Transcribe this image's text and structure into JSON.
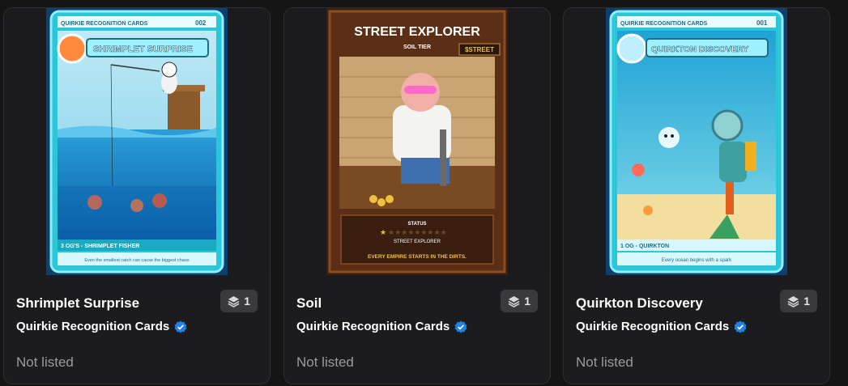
{
  "colors": {
    "background": "#151516",
    "card": "#202022",
    "verified": "#2081e2",
    "muted": "#9a9a9f"
  },
  "cards": [
    {
      "title": "Shrimplet Surprise",
      "quantity": "1",
      "collection": "Quirkie Recognition Cards",
      "status": "Not listed",
      "art": {
        "header": "QUIRKIE RECOGNITION CARDS",
        "number": "002",
        "name": "SHRIMPLET SURPRISE",
        "caption": "3 OG'S - SHRIMPLET FISHER",
        "footer": "Even the smallest catch can cause the biggest chaos"
      }
    },
    {
      "title": "Soil",
      "quantity": "1",
      "collection": "Quirkie Recognition Cards",
      "status": "Not listed",
      "art": {
        "name": "STREET EXPLORER",
        "tier": "SOIL TIER",
        "ticker": "$STREET",
        "status_label": "STATUS",
        "rank": "STREET EXPLORER",
        "footer": "EVERY EMPIRE STARTS IN THE DIRTS."
      }
    },
    {
      "title": "Quirkton Discovery",
      "quantity": "1",
      "collection": "Quirkie Recognition Cards",
      "status": "Not listed",
      "art": {
        "header": "QUIRKIE RECOGNITION CARDS",
        "number": "001",
        "name": "QUIRKTON DISCOVERY",
        "caption": "1 OG - QUIRKTON",
        "footer": "Every ocean begins with a spark"
      }
    }
  ]
}
